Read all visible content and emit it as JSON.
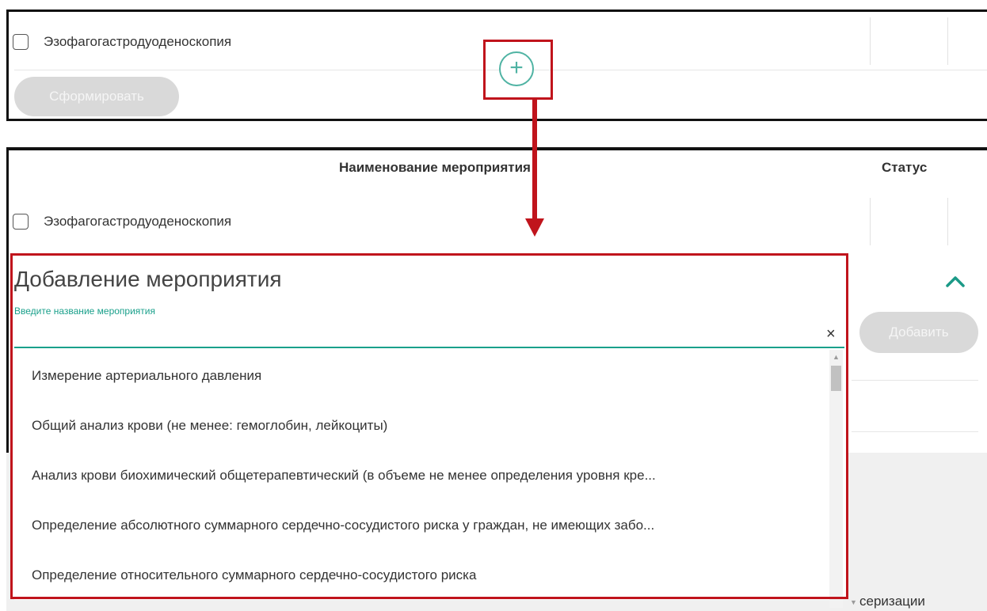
{
  "top": {
    "row_text": "Эзофагогастродуоденоскопия",
    "form_button": "Сформировать"
  },
  "plus_icon_glyph": "+",
  "table": {
    "header_name": "Наименование мероприятия",
    "header_status": "Статус",
    "row_text": "Эзофагогастродуоденоскопия"
  },
  "dialog": {
    "title": "Добавление мероприятия",
    "input_label": "Введите название мероприятия",
    "input_value": "",
    "clear_glyph": "×",
    "options": [
      "Измерение артериального давления",
      "Общий анализ крови (не менее: гемоглобин, лейкоциты)",
      "Анализ крови биохимический общетерапевтический (в объеме не менее определения уровня кре...",
      "Определение абсолютного суммарного сердечно-сосудистого риска у граждан, не имеющих забо...",
      "Определение относительного суммарного сердечно-сосудистого риска"
    ]
  },
  "add_button": "Добавить",
  "partial_text": "серизации",
  "colors": {
    "accent": "#1aa08b",
    "highlight": "#c0141c"
  }
}
